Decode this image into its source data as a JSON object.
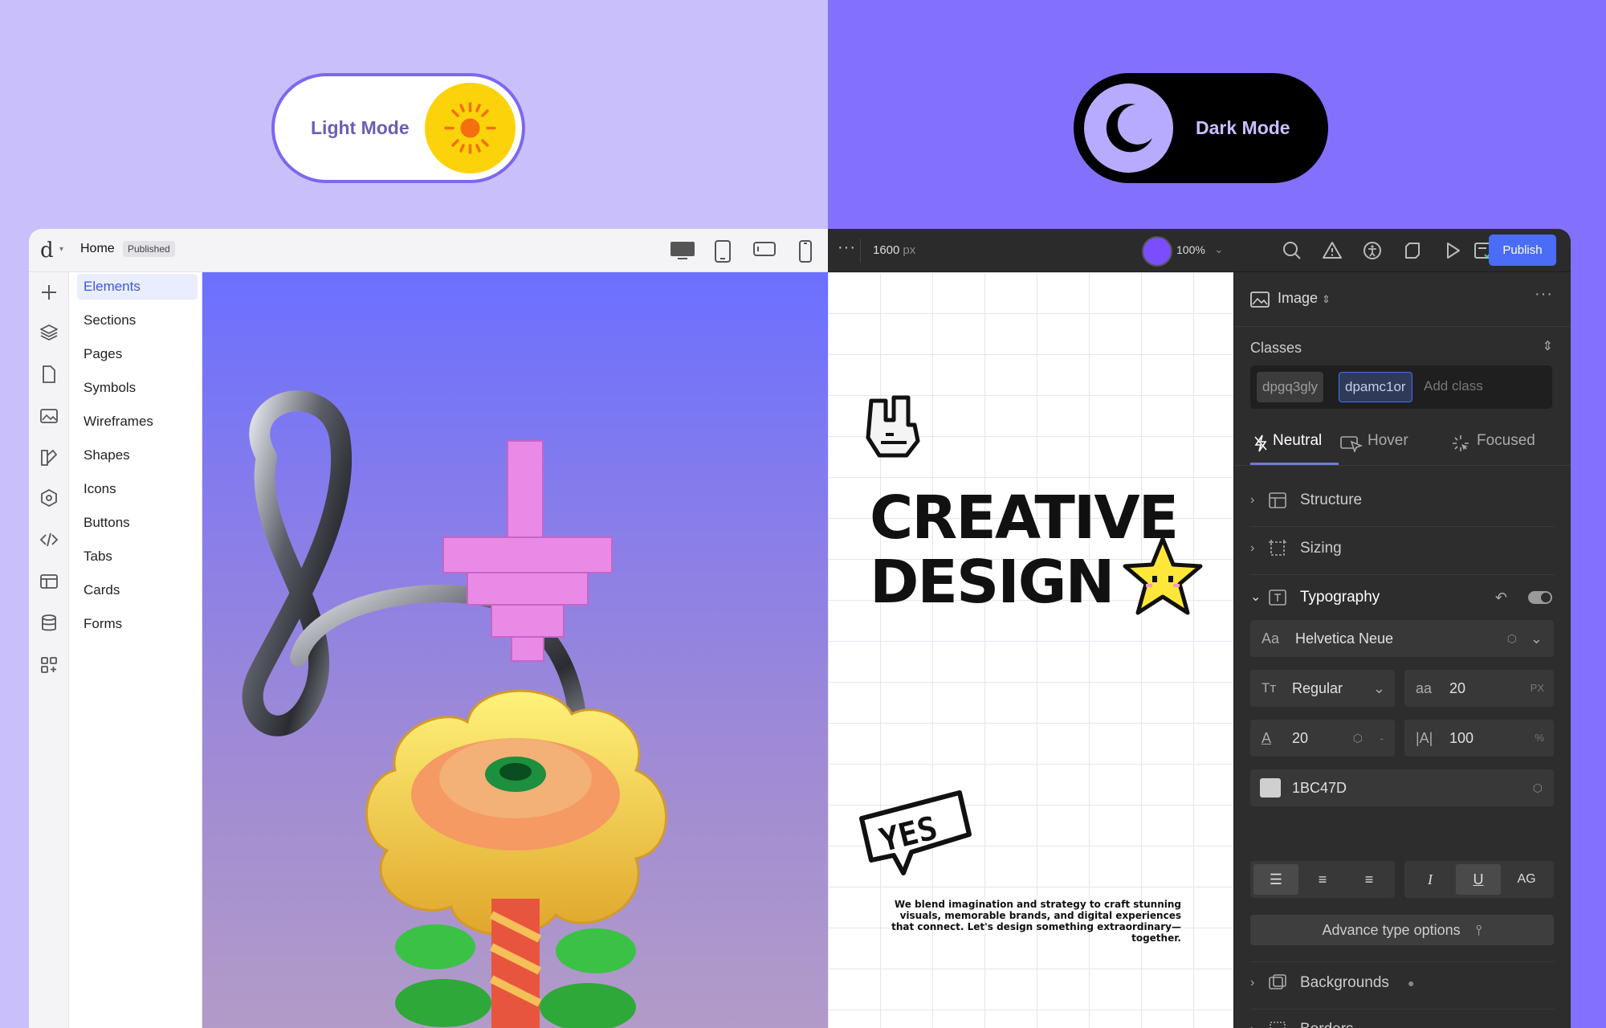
{
  "modes": {
    "light_label": "Light Mode",
    "dark_label": "Dark Mode"
  },
  "topbar": {
    "page_name": "Home",
    "status_badge": "Published",
    "more": "···",
    "canvas_width": "1600",
    "canvas_width_unit": "px",
    "zoom": "100%",
    "publish_label": "Publish"
  },
  "elements_panel": {
    "items": [
      "Elements",
      "Sections",
      "Pages",
      "Symbols",
      "Wireframes",
      "Shapes",
      "Icons",
      "Buttons",
      "Tabs",
      "Cards",
      "Forms"
    ],
    "active": "Elements"
  },
  "canvas": {
    "hero_line1": "CREATIVE",
    "hero_line2": "DESIGN",
    "hero_copy": "We blend imagination and strategy to craft stunning visuals, memorable brands, and digital experiences that connect. Let's design something extraordinary—together.",
    "sticker_text": "YES"
  },
  "properties": {
    "element_type": "Image",
    "more": "···",
    "classes_label": "Classes",
    "class_chips": [
      "dpgq3gly",
      "dpamc1or"
    ],
    "add_class_placeholder": "Add class",
    "states": [
      "Neutral",
      "Hover",
      "Focused"
    ],
    "active_state": "Neutral",
    "sections": {
      "structure": "Structure",
      "sizing": "Sizing",
      "typography": "Typography",
      "backgrounds": "Backgrounds",
      "borders": "Borders"
    },
    "typography": {
      "font_prefix": "Aa",
      "font_family": "Helvetica Neue",
      "weight": "Regular",
      "size_prefix": "aa",
      "font_size": "20",
      "font_size_unit": "PX",
      "line_height": "20",
      "line_height_dash": "-",
      "letter_spacing_prefix": "|A|",
      "width_value": "100",
      "width_unit": "%",
      "color_hex": "1BC47D",
      "case_label": "AG",
      "advanced_label": "Advance type options"
    }
  },
  "colors": {
    "left_bg": "#c9c0fb",
    "right_bg": "#8370fd",
    "accent": "#4a6cf7",
    "sun": "#fcd30a"
  }
}
